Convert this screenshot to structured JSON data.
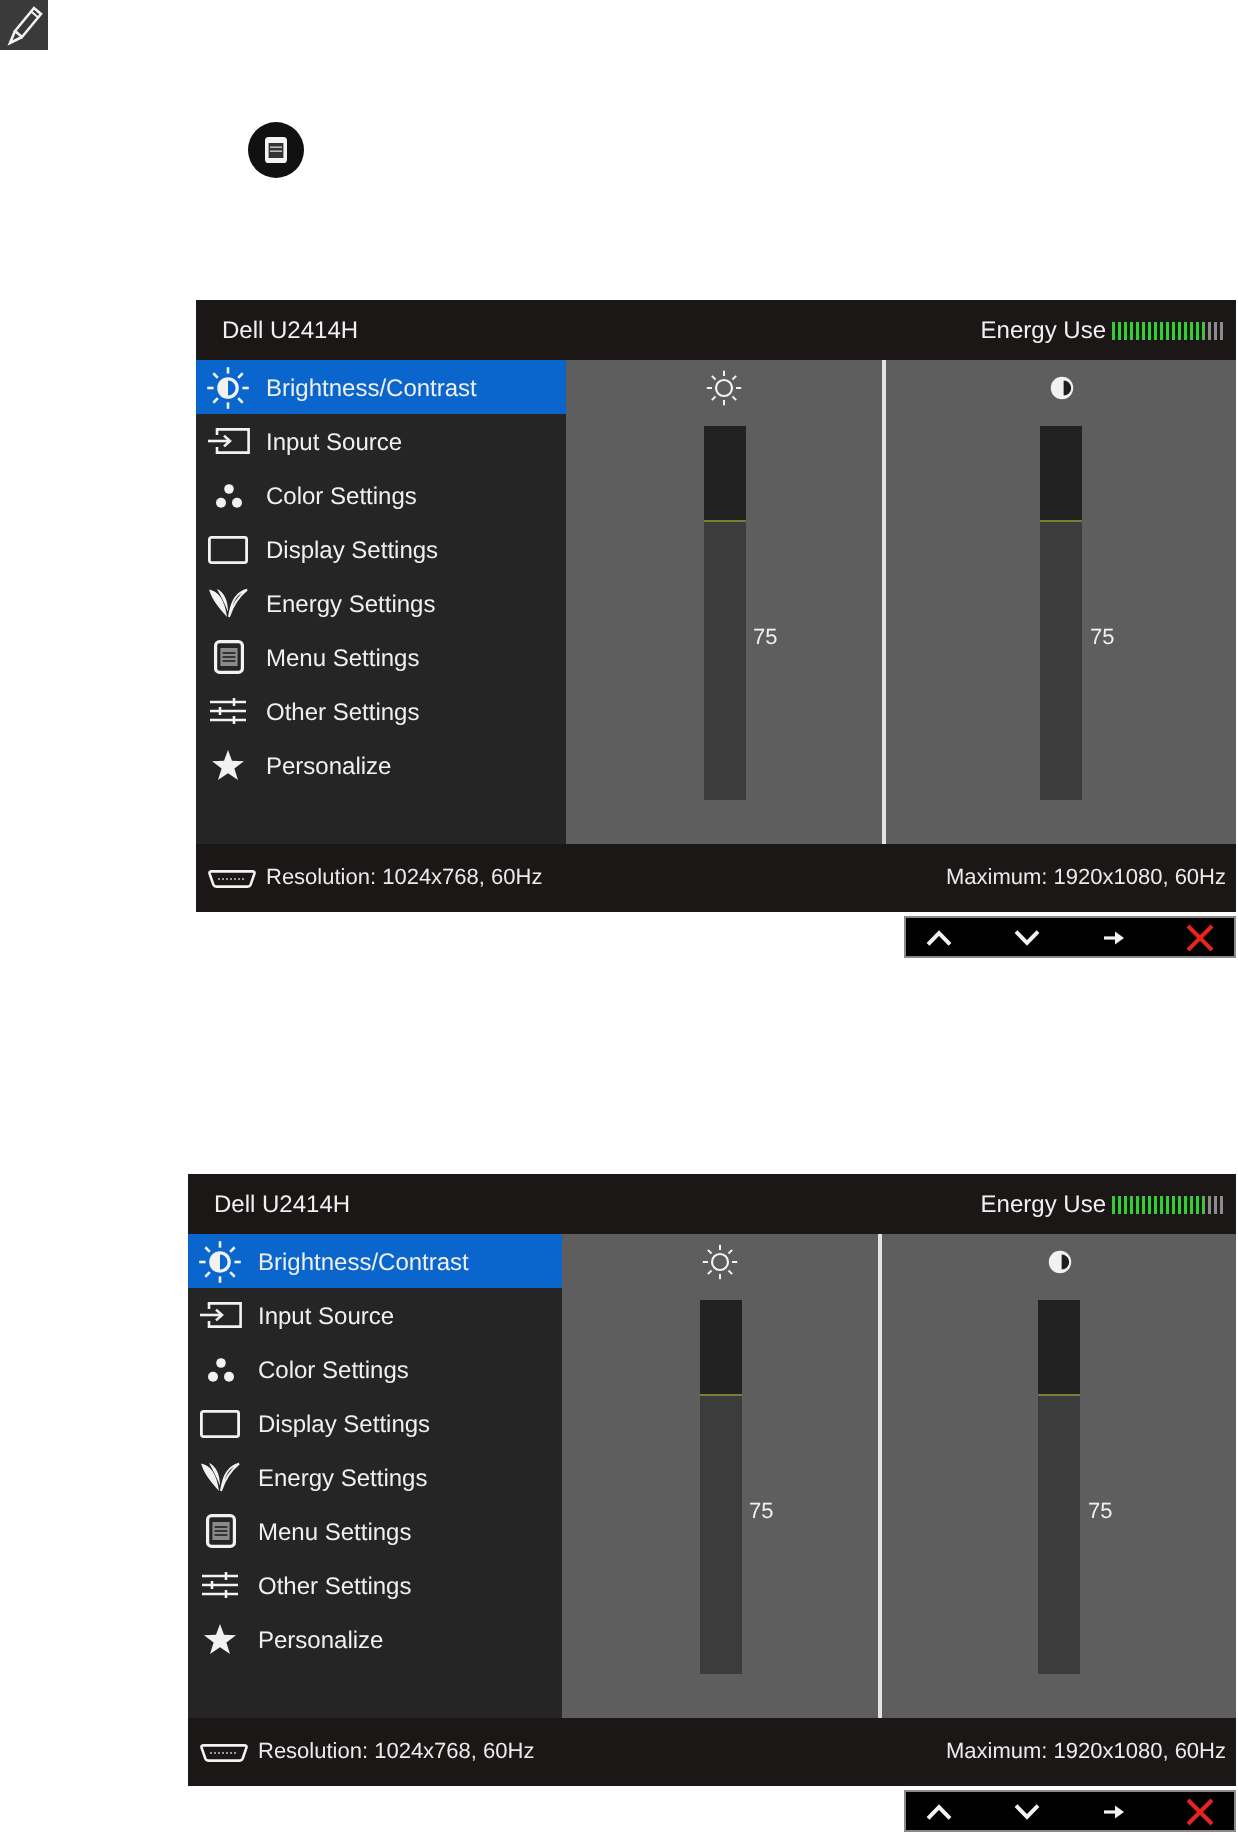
{
  "screens": [
    {
      "title": "Dell U2414H",
      "energy": {
        "label": "Energy Use",
        "level": 0.8
      },
      "menu": [
        {
          "label": "Brightness/Contrast",
          "selected": true
        },
        {
          "label": "Input Source",
          "selected": false
        },
        {
          "label": "Color Settings",
          "selected": false
        },
        {
          "label": "Display Settings",
          "selected": false
        },
        {
          "label": "Energy Settings",
          "selected": false
        },
        {
          "label": "Menu Settings",
          "selected": false
        },
        {
          "label": "Other Settings",
          "selected": false
        },
        {
          "label": "Personalize",
          "selected": false
        }
      ],
      "sliders": [
        {
          "level": 0.75,
          "reading": "75"
        },
        {
          "level": 0.75,
          "reading": "75"
        }
      ],
      "footer": {
        "resolution": "Resolution: 1024x768, 60Hz",
        "maximum": "Maximum: 1920x1080, 60Hz"
      }
    },
    {
      "title": "Dell U2414H",
      "energy": {
        "label": "Energy Use",
        "level": 0.8
      },
      "menu": [
        {
          "label": "Brightness/Contrast",
          "selected": true
        },
        {
          "label": "Input Source",
          "selected": false
        },
        {
          "label": "Color Settings",
          "selected": false
        },
        {
          "label": "Display Settings",
          "selected": false
        },
        {
          "label": "Energy Settings",
          "selected": false
        },
        {
          "label": "Menu Settings",
          "selected": false
        },
        {
          "label": "Other Settings",
          "selected": false
        },
        {
          "label": "Personalize",
          "selected": false
        }
      ],
      "sliders": [
        {
          "level": 0.75,
          "reading": "75"
        },
        {
          "level": 0.75,
          "reading": "75"
        }
      ],
      "footer": {
        "resolution": "Resolution: 1024x768, 60Hz",
        "maximum": "Maximum: 1920x1080, 60Hz"
      }
    }
  ]
}
